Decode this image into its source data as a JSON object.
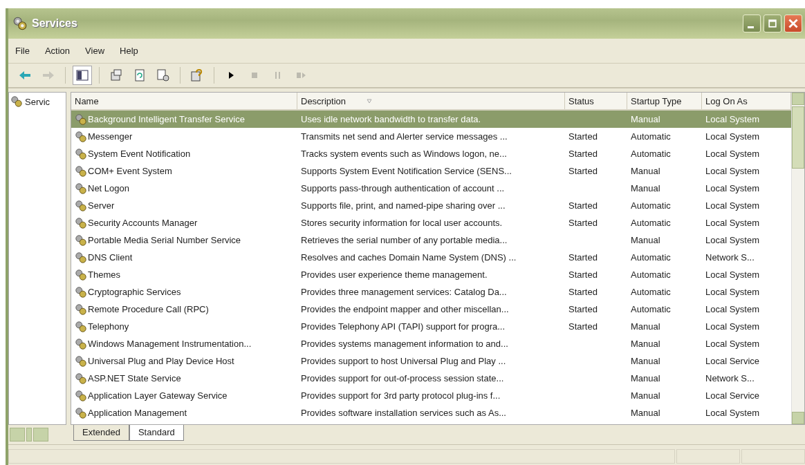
{
  "window": {
    "title": "Services"
  },
  "menu": [
    "File",
    "Action",
    "View",
    "Help"
  ],
  "toolbar": [
    {
      "kind": "back",
      "disabled": false
    },
    {
      "kind": "forward",
      "disabled": true
    },
    {
      "kind": "tree",
      "disabled": false
    },
    {
      "kind": "properties",
      "disabled": false
    },
    {
      "kind": "refresh",
      "disabled": false
    },
    {
      "kind": "export",
      "disabled": false
    },
    {
      "kind": "help",
      "disabled": false
    },
    {
      "kind": "play",
      "disabled": false
    },
    {
      "kind": "stop",
      "disabled": true
    },
    {
      "kind": "pause",
      "disabled": true
    },
    {
      "kind": "restart",
      "disabled": true
    }
  ],
  "tree": {
    "label": "Servic"
  },
  "table": {
    "columns": [
      "Name",
      "Description",
      "Status",
      "Startup Type",
      "Log On As"
    ],
    "rows": [
      {
        "name": "Background Intelligent Transfer Service",
        "description": "Uses idle network bandwidth to transfer data.",
        "status": "",
        "startup": "Manual",
        "logon": "Local System",
        "selected": true
      },
      {
        "name": "Messenger",
        "description": "Transmits net send and Alerter service messages ...",
        "status": "Started",
        "startup": "Automatic",
        "logon": "Local System",
        "selected": false
      },
      {
        "name": "System Event Notification",
        "description": "Tracks system events such as Windows logon, ne...",
        "status": "Started",
        "startup": "Automatic",
        "logon": "Local System",
        "selected": false
      },
      {
        "name": "COM+ Event System",
        "description": "Supports System Event Notification Service (SENS...",
        "status": "Started",
        "startup": "Manual",
        "logon": "Local System",
        "selected": false
      },
      {
        "name": "Net Logon",
        "description": "Supports pass-through authentication of account ...",
        "status": "",
        "startup": "Manual",
        "logon": "Local System",
        "selected": false
      },
      {
        "name": "Server",
        "description": "Supports file, print, and named-pipe sharing over ...",
        "status": "Started",
        "startup": "Automatic",
        "logon": "Local System",
        "selected": false
      },
      {
        "name": "Security Accounts Manager",
        "description": "Stores security information for local user accounts.",
        "status": "Started",
        "startup": "Automatic",
        "logon": "Local System",
        "selected": false
      },
      {
        "name": "Portable Media Serial Number Service",
        "description": "Retrieves the serial number of any portable media...",
        "status": "",
        "startup": "Manual",
        "logon": "Local System",
        "selected": false
      },
      {
        "name": "DNS Client",
        "description": "Resolves and caches Domain Name System (DNS) ...",
        "status": "Started",
        "startup": "Automatic",
        "logon": "Network S...",
        "selected": false
      },
      {
        "name": "Themes",
        "description": "Provides user experience theme management.",
        "status": "Started",
        "startup": "Automatic",
        "logon": "Local System",
        "selected": false
      },
      {
        "name": "Cryptographic Services",
        "description": "Provides three management services: Catalog Da...",
        "status": "Started",
        "startup": "Automatic",
        "logon": "Local System",
        "selected": false
      },
      {
        "name": "Remote Procedure Call (RPC)",
        "description": "Provides the endpoint mapper and other miscellan...",
        "status": "Started",
        "startup": "Automatic",
        "logon": "Local System",
        "selected": false
      },
      {
        "name": "Telephony",
        "description": "Provides Telephony API (TAPI) support for progra...",
        "status": "Started",
        "startup": "Manual",
        "logon": "Local System",
        "selected": false
      },
      {
        "name": "Windows Management Instrumentation...",
        "description": "Provides systems management information to and...",
        "status": "",
        "startup": "Manual",
        "logon": "Local System",
        "selected": false
      },
      {
        "name": "Universal Plug and Play Device Host",
        "description": "Provides support to host Universal Plug and Play ...",
        "status": "",
        "startup": "Manual",
        "logon": "Local Service",
        "selected": false
      },
      {
        "name": "ASP.NET State Service",
        "description": "Provides support for out-of-process session state...",
        "status": "",
        "startup": "Manual",
        "logon": "Network S...",
        "selected": false
      },
      {
        "name": "Application Layer Gateway Service",
        "description": "Provides support for 3rd party protocol plug-ins f...",
        "status": "",
        "startup": "Manual",
        "logon": "Local Service",
        "selected": false
      },
      {
        "name": "Application Management",
        "description": "Provides software installation services such as As...",
        "status": "",
        "startup": "Manual",
        "logon": "Local System",
        "selected": false
      }
    ]
  },
  "tabs": [
    {
      "label": "Extended",
      "selected": false
    },
    {
      "label": "Standard",
      "selected": true
    }
  ]
}
